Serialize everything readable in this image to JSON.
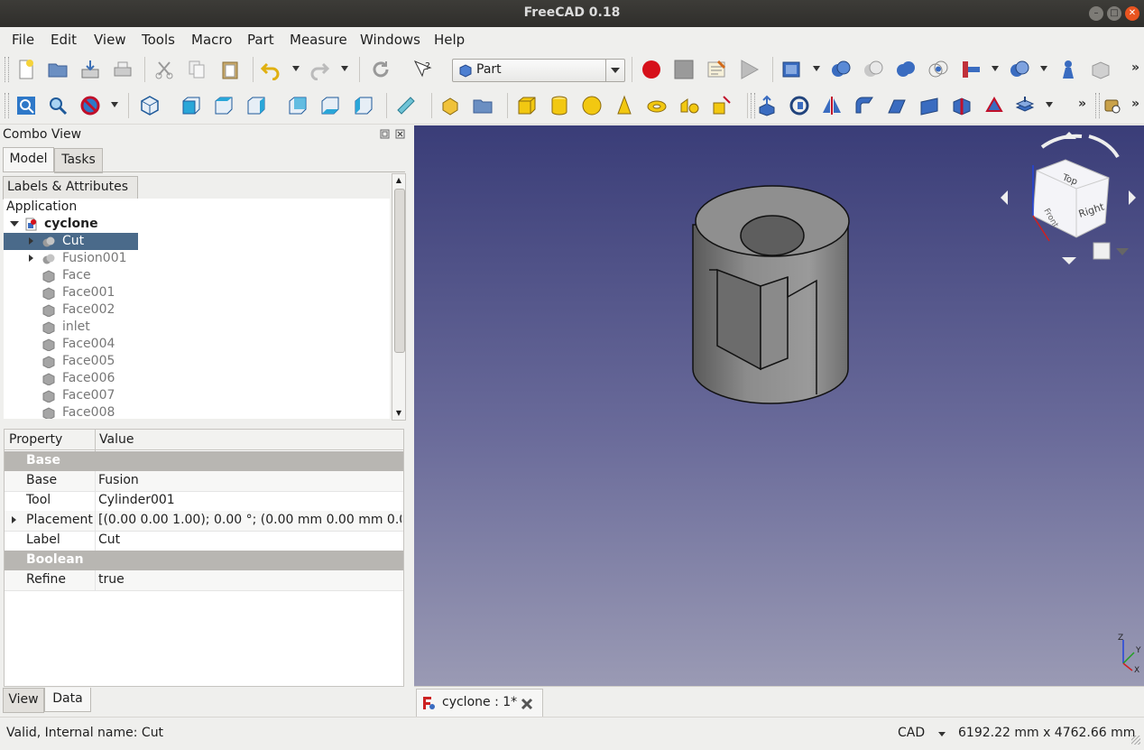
{
  "window": {
    "title": "FreeCAD 0.18"
  },
  "menu": {
    "items": [
      "File",
      "Edit",
      "View",
      "Tools",
      "Macro",
      "Part",
      "Measure",
      "Windows",
      "Help"
    ]
  },
  "toolbar": {
    "workbench": "Part",
    "workbench_icon": "part-cube-icon"
  },
  "combo_view": {
    "title": "Combo View",
    "tabs": [
      "Model",
      "Tasks"
    ],
    "labels_header": "Labels & Attributes",
    "tree": {
      "root": "Application",
      "document": "cyclone",
      "items": [
        "Cut",
        "Fusion001",
        "Face",
        "Face001",
        "Face002",
        "inlet",
        "Face004",
        "Face005",
        "Face006",
        "Face007",
        "Face008"
      ],
      "selected": "Cut"
    },
    "property_header": {
      "property": "Property",
      "value": "Value"
    },
    "properties": {
      "group_base": "Base",
      "base_label": "Base",
      "base_value": "Fusion",
      "tool_label": "Tool",
      "tool_value": "Cylinder001",
      "placement_label": "Placement",
      "placement_value": "[(0.00 0.00 1.00); 0.00 °; (0.00 mm  0.00 mm  0.0…",
      "label_label": "Label",
      "label_value": "Cut",
      "group_boolean": "Boolean",
      "refine_label": "Refine",
      "refine_value": "true"
    },
    "bottom_tabs": [
      "View",
      "Data"
    ]
  },
  "navcube": {
    "top": "Top",
    "right": "Right",
    "front": "Front"
  },
  "axes": {
    "x": "X",
    "y": "Y",
    "z": "Z"
  },
  "document_tab": {
    "label": "cyclone : 1*"
  },
  "status": {
    "message": "Valid, Internal name: Cut",
    "nav_style": "CAD",
    "dimensions": "6192.22 mm x 4762.66 mm"
  },
  "colors": {
    "selection": "#4a6a8a",
    "viewport_top": "#3a3d78",
    "viewport_bottom": "#9a9ab4",
    "accent_close": "#e95420"
  }
}
